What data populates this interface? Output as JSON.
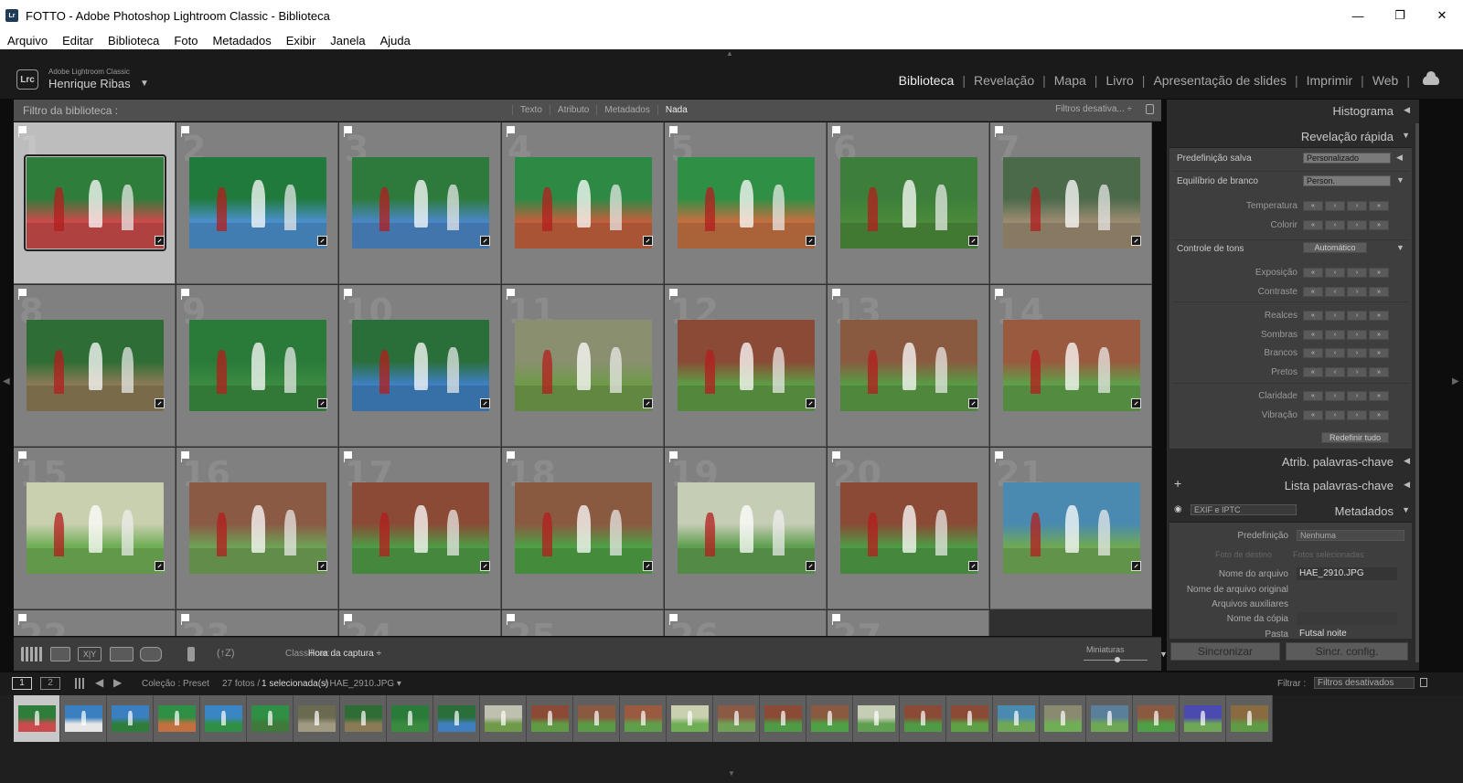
{
  "window": {
    "title": "FOTTO - Adobe Photoshop Lightroom Classic - Biblioteca",
    "app_icon": "Lr"
  },
  "menu": [
    "Arquivo",
    "Editar",
    "Biblioteca",
    "Foto",
    "Metadados",
    "Exibir",
    "Janela",
    "Ajuda"
  ],
  "identity": {
    "logo": "Lrc",
    "brand": "Adobe Lightroom Classic",
    "user": "Henrique Ribas"
  },
  "modules": [
    "Biblioteca",
    "Revelação",
    "Mapa",
    "Livro",
    "Apresentação de slides",
    "Imprimir",
    "Web"
  ],
  "active_module": "Biblioteca",
  "filterbar": {
    "label": "Filtro da biblioteca :",
    "tabs": [
      "Texto",
      "Atributo",
      "Metadados",
      "Nada"
    ],
    "active_tab": "Nada",
    "preset": "Filtros desativa... ÷"
  },
  "grid": {
    "selected": 1,
    "cells": [
      {
        "n": "1",
        "colors": [
          "#2f7d3a",
          "#c94b4b"
        ]
      },
      {
        "n": "2",
        "colors": [
          "#1f7a3c",
          "#4a8fc9"
        ]
      },
      {
        "n": "3",
        "colors": [
          "#2d7a3c",
          "#4a86c3"
        ]
      },
      {
        "n": "4",
        "colors": [
          "#2c8a45",
          "#c0603d"
        ]
      },
      {
        "n": "5",
        "colors": [
          "#2f8f44",
          "#c27040"
        ]
      },
      {
        "n": "6",
        "colors": [
          "#3d7f3a",
          "#4a8a3a"
        ]
      },
      {
        "n": "7",
        "colors": [
          "#4a6a4a",
          "#9a8a70"
        ]
      },
      {
        "n": "8",
        "colors": [
          "#2e6d35",
          "#8a7a55"
        ]
      },
      {
        "n": "9",
        "colors": [
          "#2a7a3a",
          "#3a8a40"
        ]
      },
      {
        "n": "10",
        "colors": [
          "#2a6f3a",
          "#3f7fbf"
        ]
      },
      {
        "n": "11",
        "colors": [
          "#8a8f70",
          "#6f9a4a"
        ]
      },
      {
        "n": "12",
        "colors": [
          "#8a4a35",
          "#5f9a45"
        ]
      },
      {
        "n": "13",
        "colors": [
          "#8a5a40",
          "#5a9a45"
        ]
      },
      {
        "n": "14",
        "colors": [
          "#9a5a40",
          "#5f9f4a"
        ]
      },
      {
        "n": "15",
        "colors": [
          "#c9d0b0",
          "#6fae55"
        ]
      },
      {
        "n": "16",
        "colors": [
          "#8a5a45",
          "#6fa055"
        ]
      },
      {
        "n": "17",
        "colors": [
          "#8a4a35",
          "#4f9a45"
        ]
      },
      {
        "n": "18",
        "colors": [
          "#8a5a40",
          "#4f9f45"
        ]
      },
      {
        "n": "19",
        "colors": [
          "#c6cdb5",
          "#5f9f50"
        ]
      },
      {
        "n": "20",
        "colors": [
          "#8a4a35",
          "#4f9a45"
        ]
      },
      {
        "n": "21",
        "colors": [
          "#4a8ab0",
          "#6fa855"
        ]
      },
      {
        "n": "22",
        "colors": []
      },
      {
        "n": "23",
        "colors": []
      },
      {
        "n": "24",
        "colors": []
      },
      {
        "n": "25",
        "colors": []
      },
      {
        "n": "26",
        "colors": []
      },
      {
        "n": "27",
        "colors": []
      }
    ]
  },
  "toolbar": {
    "sort_label": "Classificar:",
    "sort_value": "Hora da captura ÷",
    "thumbs_label": "Miniaturas",
    "xy": "X|Y"
  },
  "right_panel": {
    "histogram": "Histograma",
    "quick_develop": "Revelação rápida",
    "saved_preset_label": "Predefinição salva",
    "saved_preset_value": "Personalizado",
    "wb_label": "Equilíbrio de branco",
    "wb_value": "Person.",
    "temp_label": "Temperatura",
    "tint_label": "Colorir",
    "tone_label": "Controle de tons",
    "auto_label": "Automático",
    "exposure": "Exposição",
    "contrast": "Contraste",
    "highlights": "Realces",
    "shadows": "Sombras",
    "whites": "Brancos",
    "blacks": "Pretos",
    "clarity": "Claridade",
    "vibrance": "Vibração",
    "reset": "Redefinir tudo",
    "keywording": "Atrib. palavras-chave",
    "keyword_list": "Lista palavras-chave",
    "metadata": "Metadados",
    "metadata_set": "EXIF e IPTC",
    "metadata_preset_label": "Predefinição",
    "metadata_preset_value": "Nenhuma",
    "target_photo": "Foto de destino",
    "selected_photos": "Fotos selecionadas",
    "filename_label": "Nome do arquivo",
    "filename_value": "HAE_2910.JPG",
    "orig_filename_label": "Nome de arquivo original",
    "sidecar_label": "Arquivos auxiliares",
    "copy_name_label": "Nome da cópia",
    "folder_label": "Pasta",
    "folder_value": "Futsal noite",
    "sync": "Sincronizar",
    "sync_settings": "Sincr. config."
  },
  "filmstrip_header": {
    "screen1": "1",
    "screen2": "2",
    "collection": "Coleção : Preset",
    "count": "27 fotos /",
    "selected": "1 selecionada(s)",
    "file": "/ HAE_2910.JPG ▾",
    "filter_label": "Filtrar :",
    "filter_value": "Filtros desativados"
  },
  "filmstrip": [
    [
      "#2f7d3a",
      "#c94b4b"
    ],
    [
      "#3a7fc0",
      "#e6e6e6"
    ],
    [
      "#3a7fc0",
      "#2f7d3a"
    ],
    [
      "#2f8f44",
      "#c27040"
    ],
    [
      "#3a85c4",
      "#2f8f44"
    ],
    [
      "#2f8f44",
      "#3f7a3a"
    ],
    [
      "#6a6a50",
      "#a09a80"
    ],
    [
      "#2e6d35",
      "#8a7a55"
    ],
    [
      "#2a7a3a",
      "#3a8a40"
    ],
    [
      "#2a6f3a",
      "#3f7fbf"
    ],
    [
      "#c0c0b0",
      "#6f9a4a"
    ],
    [
      "#8a4a35",
      "#5f9a45"
    ],
    [
      "#8a5a40",
      "#5a9a45"
    ],
    [
      "#9a5a40",
      "#5f9f4a"
    ],
    [
      "#c9d0b0",
      "#6fae55"
    ],
    [
      "#8a5a45",
      "#6fa055"
    ],
    [
      "#8a4a35",
      "#4f9a45"
    ],
    [
      "#8a5a40",
      "#4f9f45"
    ],
    [
      "#c6cdb5",
      "#5f9f50"
    ],
    [
      "#8a4a35",
      "#4f9a45"
    ],
    [
      "#8a4a35",
      "#5f9f45"
    ],
    [
      "#4a8ab0",
      "#6fa855"
    ],
    [
      "#8a8a70",
      "#6fae55"
    ],
    [
      "#5a7f9a",
      "#6fa855"
    ],
    [
      "#8a5a40",
      "#4f9f45"
    ],
    [
      "#4a4ab0",
      "#6fa855"
    ],
    [
      "#8a6a40",
      "#5f9a45"
    ]
  ]
}
